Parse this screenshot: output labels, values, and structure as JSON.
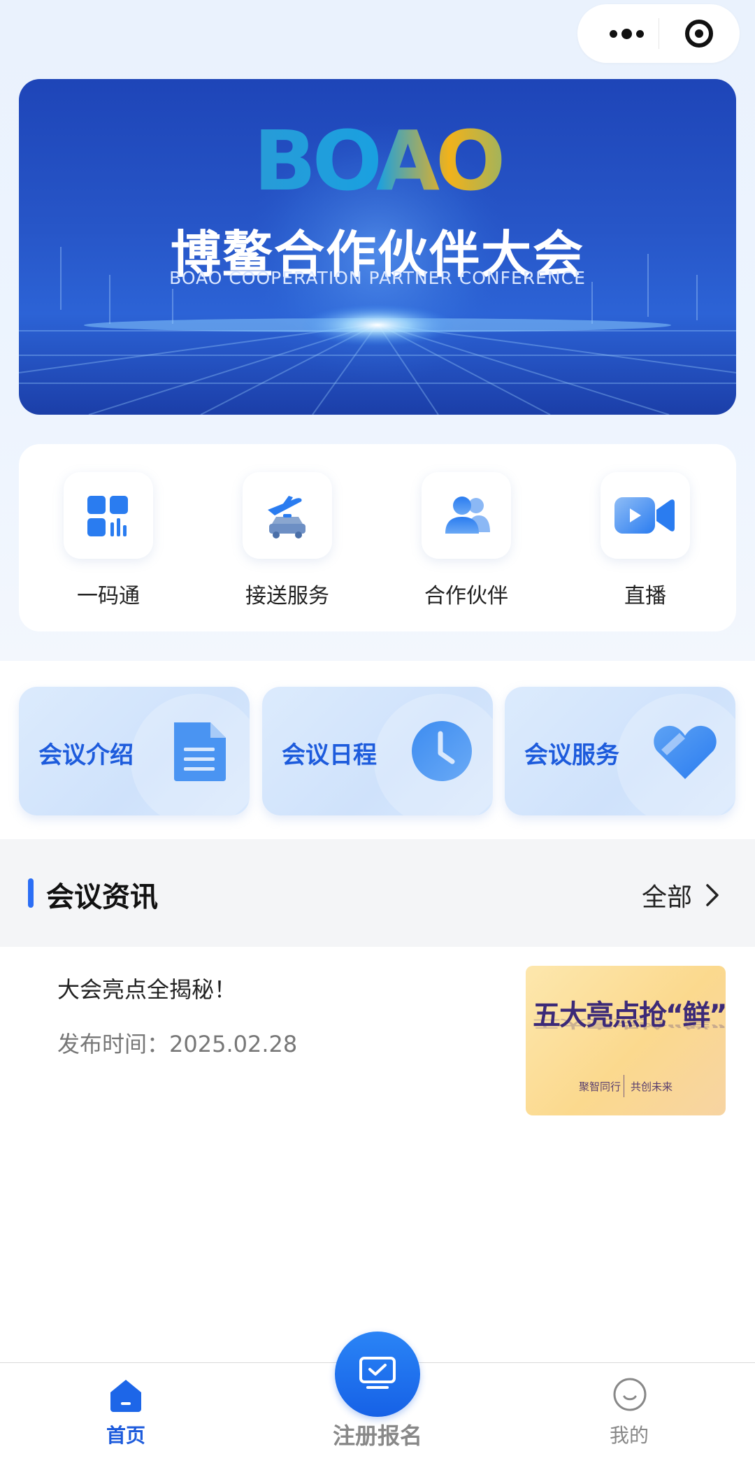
{
  "capsule": {
    "more_icon": "more-dots-icon",
    "close_icon": "target-circle-icon"
  },
  "banner": {
    "logo": "BOAO",
    "title": "博鳌合作伙伴大会",
    "subtitle": "BOAO COOPERATION PARTNER CONFERENCE"
  },
  "quick_menu": [
    {
      "label": "一码通",
      "icon": "qr-grid-icon"
    },
    {
      "label": "接送服务",
      "icon": "plane-car-icon"
    },
    {
      "label": "合作伙伴",
      "icon": "partners-icon"
    },
    {
      "label": "直播",
      "icon": "video-camera-icon"
    }
  ],
  "sections": [
    {
      "label": "会议介绍",
      "icon": "document-icon"
    },
    {
      "label": "会议日程",
      "icon": "clock-icon"
    },
    {
      "label": "会议服务",
      "icon": "heart-icon"
    }
  ],
  "news": {
    "title": "会议资讯",
    "all_label": "全部",
    "items": [
      {
        "title": "大会亮点全揭秘！",
        "date": "发布时间：2025.02.28",
        "thumb_headline": "五大亮点抢“鲜”看",
        "thumb_tag1": "聚智同行",
        "thumb_tag2": "共创未来"
      }
    ]
  },
  "tabbar": {
    "home_label": "首页",
    "register_label": "注册报名",
    "mine_label": "我的"
  },
  "colors": {
    "accent": "#1d5bdc",
    "brand_blue": "#2b6ef5"
  }
}
